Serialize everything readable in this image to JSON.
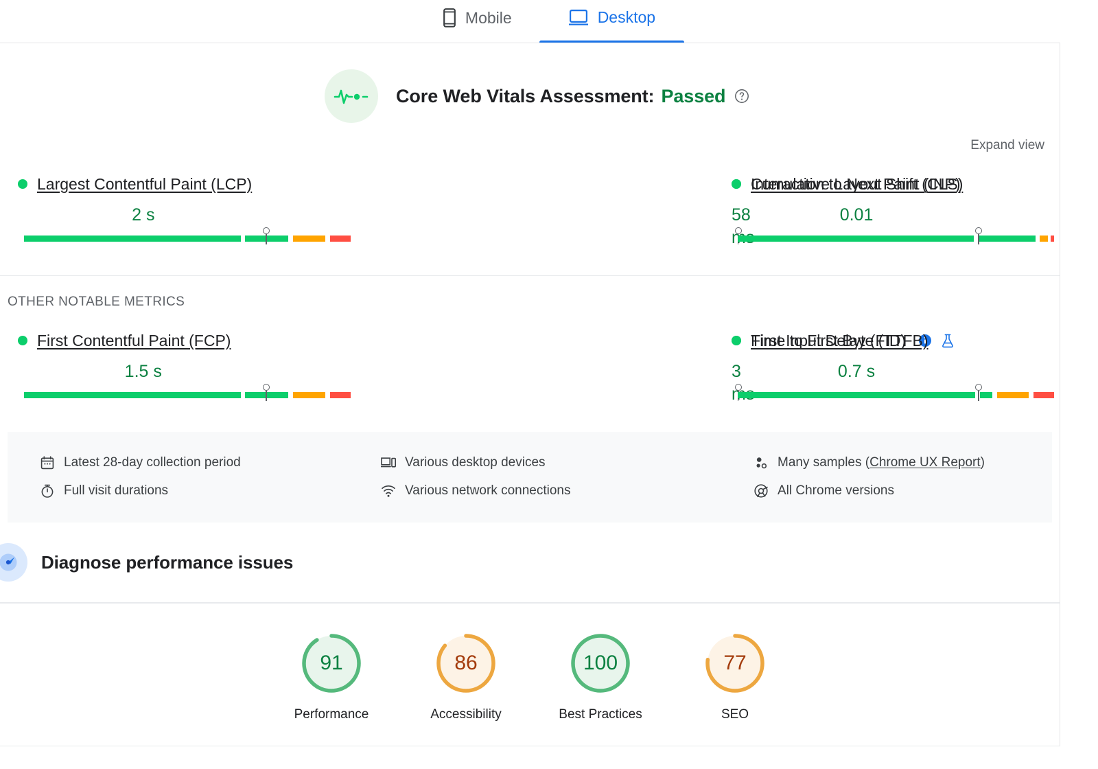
{
  "tabs": [
    {
      "label": "Mobile",
      "icon": "mobile-icon",
      "active": false
    },
    {
      "label": "Desktop",
      "icon": "desktop-icon",
      "active": true
    }
  ],
  "assessment": {
    "icon": "pulse-icon",
    "title": "Core Web Vitals Assessment:",
    "status": "Passed",
    "status_color": "#0c8141",
    "help_icon": "help-circle-icon"
  },
  "expand_view_label": "Expand view",
  "core_metrics": [
    {
      "name": "Largest Contentful Paint (LCP)",
      "value": "2 s",
      "status": "good",
      "dot_color": "#0cce6b",
      "marker_pct": 74,
      "segments": [
        {
          "color": "green",
          "pct": 73
        },
        {
          "color": "gap",
          "pct": 1.5
        },
        {
          "color": "green",
          "pct": 14.5
        },
        {
          "color": "gap",
          "pct": 1.5
        },
        {
          "color": "orange",
          "pct": 11
        },
        {
          "color": "gap",
          "pct": 1.5
        },
        {
          "color": "red",
          "pct": 7
        }
      ]
    },
    {
      "name": "Interaction to Next Paint (INP)",
      "value": "58 ms",
      "status": "good",
      "dot_color": "#0cce6b",
      "marker_pct": 75,
      "segments": [
        {
          "color": "green",
          "pct": 74
        },
        {
          "color": "gap",
          "pct": 1.5
        },
        {
          "color": "green",
          "pct": 19
        },
        {
          "color": "gap",
          "pct": 1.5
        },
        {
          "color": "orange",
          "pct": 3.5
        },
        {
          "color": "gap",
          "pct": 1.5
        },
        {
          "color": "red",
          "pct": 1
        }
      ]
    },
    {
      "name": "Cumulative Layout Shift (CLS)",
      "value": "0.01",
      "status": "good",
      "dot_color": "#0cce6b",
      "marker_pct": 76,
      "segments": [
        {
          "color": "green",
          "pct": 75
        },
        {
          "color": "gap",
          "pct": 1.5
        },
        {
          "color": "green",
          "pct": 18
        },
        {
          "color": "gap",
          "pct": 1.5
        },
        {
          "color": "orange",
          "pct": 2.5
        },
        {
          "color": "gap",
          "pct": 1
        },
        {
          "color": "red",
          "pct": 1
        }
      ]
    }
  ],
  "other_metrics_title": "OTHER NOTABLE METRICS",
  "other_metrics": [
    {
      "name": "First Contentful Paint (FCP)",
      "value": "1.5 s",
      "status": "good",
      "dot_color": "#0cce6b",
      "badge": null,
      "marker_pct": 74,
      "segments": [
        {
          "color": "green",
          "pct": 73
        },
        {
          "color": "gap",
          "pct": 1.5
        },
        {
          "color": "green",
          "pct": 14.5
        },
        {
          "color": "gap",
          "pct": 1.5
        },
        {
          "color": "orange",
          "pct": 11
        },
        {
          "color": "gap",
          "pct": 1.5
        },
        {
          "color": "red",
          "pct": 7
        }
      ]
    },
    {
      "name": "First Input Delay (FID)",
      "value": "3 ms",
      "status": "good",
      "dot_color": "#0cce6b",
      "badge": "info-icon",
      "marker_pct": 75,
      "segments": [
        {
          "color": "green",
          "pct": 74
        },
        {
          "color": "gap",
          "pct": 1.5
        },
        {
          "color": "green",
          "pct": 21
        },
        {
          "color": "gap",
          "pct": 1
        },
        {
          "color": "orange",
          "pct": 1.5
        },
        {
          "color": "gap",
          "pct": 0.5
        },
        {
          "color": "red",
          "pct": 0.5
        }
      ]
    },
    {
      "name": "Time to First Byte (TTFB)",
      "value": "0.7 s",
      "status": "good",
      "dot_color": "#0cce6b",
      "badge": "flask-icon",
      "marker_pct": 76,
      "segments": [
        {
          "color": "green",
          "pct": 75
        },
        {
          "color": "gap",
          "pct": 1.5
        },
        {
          "color": "green",
          "pct": 4
        },
        {
          "color": "gap",
          "pct": 1.5
        },
        {
          "color": "orange",
          "pct": 10
        },
        {
          "color": "gap",
          "pct": 1.5
        },
        {
          "color": "red",
          "pct": 6.5
        }
      ]
    }
  ],
  "meta": {
    "col1": [
      {
        "icon": "calendar-icon",
        "text": "Latest 28-day collection period"
      },
      {
        "icon": "stopwatch-icon",
        "text": "Full visit durations"
      }
    ],
    "col2": [
      {
        "icon": "devices-icon",
        "text": "Various desktop devices"
      },
      {
        "icon": "network-icon",
        "text": "Various network connections"
      }
    ],
    "col3": [
      {
        "icon": "samples-icon",
        "text": "Many samples (",
        "link": "Chrome UX Report",
        "text_after": ")"
      },
      {
        "icon": "chrome-icon",
        "text": "All Chrome versions"
      }
    ]
  },
  "diagnose": {
    "icon": "gauge-icon",
    "title": "Diagnose performance issues"
  },
  "scores": [
    {
      "value": "91",
      "label": "Performance",
      "ring_color": "#55b97c",
      "fill_color": "#e8f5ec",
      "text_color": "#0c8141",
      "pct": 91
    },
    {
      "value": "86",
      "label": "Accessibility",
      "ring_color": "#eda740",
      "fill_color": "#fdf3e6",
      "text_color": "#a33b0c",
      "pct": 86
    },
    {
      "value": "100",
      "label": "Best Practices",
      "ring_color": "#55b97c",
      "fill_color": "#e8f5ec",
      "text_color": "#0c8141",
      "pct": 100
    },
    {
      "value": "77",
      "label": "SEO",
      "ring_color": "#eda740",
      "fill_color": "#fdf3e6",
      "text_color": "#a33b0c",
      "pct": 77
    }
  ]
}
